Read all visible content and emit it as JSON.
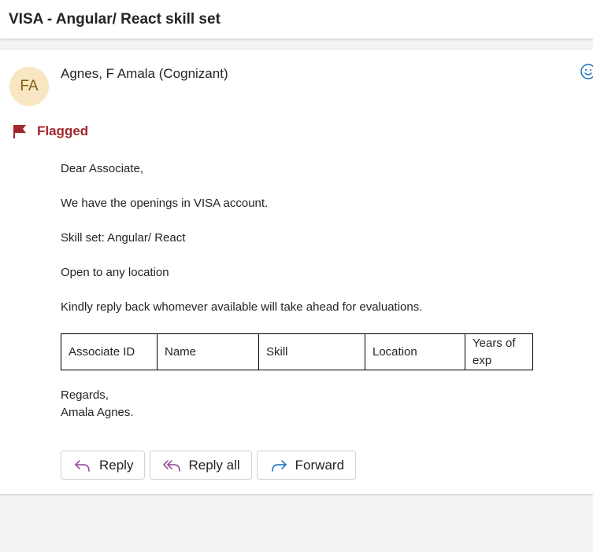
{
  "email": {
    "subject": "VISA - Angular/ React skill set",
    "sender_initials": "FA",
    "sender_name": "Agnes, F Amala (Cognizant)",
    "flag_status": "Flagged",
    "body": {
      "greeting": "Dear Associate,",
      "line1": "We have the openings in VISA account.",
      "line2": "Skill set: Angular/ React",
      "line3": "Open to any location",
      "line4": "Kindly reply back whomever available will take ahead for evaluations.",
      "table_headers": [
        "Associate ID",
        "Name",
        "Skill",
        "Location",
        "Years of exp"
      ],
      "signoff": "Regards,",
      "signature": "Amala Agnes."
    }
  },
  "actions": {
    "reply_label": "Reply",
    "reply_all_label": "Reply all",
    "forward_label": "Forward"
  },
  "icons": {
    "flag": "flag-icon",
    "reaction": "smiley-icon",
    "reply": "reply-arrow-icon",
    "reply_all": "reply-all-arrow-icon",
    "forward": "forward-arrow-icon"
  },
  "colors": {
    "flag": "#a4262c",
    "avatar_bg": "#f8e7c2",
    "avatar_text": "#8a5a17",
    "reply_icon": "#8e3f8f",
    "forward_icon": "#0f6cbd"
  }
}
